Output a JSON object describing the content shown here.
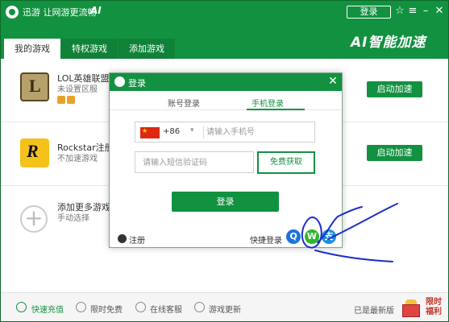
{
  "header": {
    "title": "迅游 让网游更流畅",
    "ai_mark": "AI",
    "login_label": "登录",
    "brand": "AI智能加速",
    "controls": {
      "skin": "☆",
      "menu": "≡",
      "minimize": "–",
      "close": "✕"
    }
  },
  "tabs": [
    {
      "label": "我的游戏",
      "active": true
    },
    {
      "label": "特权游戏",
      "active": false
    },
    {
      "label": "添加游戏",
      "active": false
    }
  ],
  "games": [
    {
      "name": "LOL英雄联盟",
      "sub": "未设置区服",
      "button": "启动加速",
      "icon": "lol-icon"
    },
    {
      "name": "Rockstar注册下",
      "sub": "不加速游戏",
      "button": "启动加速",
      "icon": "rockstar-icon"
    }
  ],
  "add_game": {
    "name": "添加更多游戏",
    "sub": "手动选择",
    "icon_glyph": "+"
  },
  "footer": {
    "items": [
      {
        "label": "快速充值",
        "icon": "coin-icon"
      },
      {
        "label": "限时免费",
        "icon": "clock-icon"
      },
      {
        "label": "在线客服",
        "icon": "chat-icon"
      },
      {
        "label": "游戏更新",
        "icon": "refresh-icon"
      }
    ],
    "status": "已是最新版",
    "promo": "限时福利"
  },
  "dialog": {
    "title": "登录",
    "close": "✕",
    "tabs": [
      {
        "label": "账号登录",
        "active": false
      },
      {
        "label": "手机登录",
        "active": true
      }
    ],
    "country_code": "+86",
    "country_caret": "▾",
    "flag_star": "★",
    "phone_placeholder": "请输入手机号",
    "code_placeholder": "请输入短信验证码",
    "get_code": "免费获取",
    "submit": "登录",
    "register": "注册",
    "quick_login": "快捷登录",
    "quick_icons": {
      "qq": "Q",
      "wechat": "W",
      "alipay": "支"
    }
  },
  "colors": {
    "brand_green": "#129140",
    "scribble_blue": "#1c2fc8"
  }
}
